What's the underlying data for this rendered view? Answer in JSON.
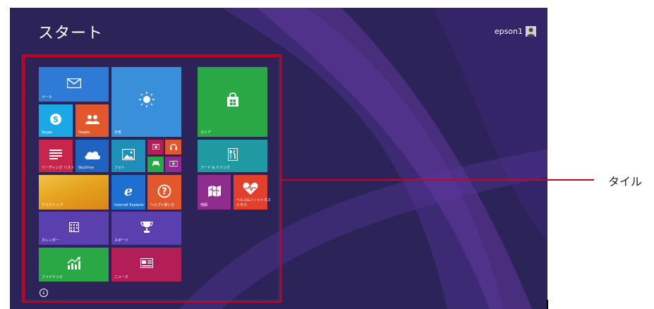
{
  "screen": {
    "title": "スタート",
    "username": "epson1",
    "scroll_glyph": "↓"
  },
  "tiles": {
    "mail": {
      "label": "メール",
      "color": "#2d7bd6",
      "icon": "envelope-icon"
    },
    "weather": {
      "label": "天気",
      "color": "#3a8fdb",
      "icon": "sun-icon"
    },
    "store": {
      "label": "ストア",
      "color": "#2aa845",
      "icon": "shopping-bag-icon"
    },
    "skype": {
      "label": "Skype",
      "color": "#1aa8e6",
      "icon": "skype-icon"
    },
    "people": {
      "label": "People",
      "color": "#e2582c",
      "icon": "people-icon"
    },
    "reading_list": {
      "label": "リーディング リスト",
      "color": "#c8254c",
      "icon": "list-icon"
    },
    "skydrive": {
      "label": "SkyDrive",
      "color": "#1f62c0",
      "icon": "cloud-icon"
    },
    "photos": {
      "label": "フォト",
      "color": "#1e8fb8",
      "icon": "picture-icon"
    },
    "camera": {
      "color": "#b21e55",
      "icon": "camera-icon"
    },
    "music": {
      "color": "#e2582c",
      "icon": "headphones-icon"
    },
    "games": {
      "color": "#2aa845",
      "icon": "gamepad-icon"
    },
    "video": {
      "color": "#8e2d8e",
      "icon": "video-icon"
    },
    "food": {
      "label": "フード & ドリンク",
      "color": "#1e9aa0",
      "icon": "fork-knife-icon"
    },
    "desktop": {
      "label": "デスクトップ",
      "color": "#e6a41e"
    },
    "ie": {
      "label": "Internet Explorer",
      "color": "#1f6fd0",
      "icon": "internet-explorer-icon"
    },
    "help": {
      "label": "ヘルプ+使い方",
      "color": "#e2582c",
      "icon": "question-icon"
    },
    "maps": {
      "label": "地図",
      "color": "#8e2d8e",
      "icon": "map-icon"
    },
    "health": {
      "label": "ヘルス&フィットネス",
      "label_sub": "トネス",
      "color": "#e2402c",
      "icon": "heartbeat-icon"
    },
    "calendar": {
      "label": "カレンダー",
      "color": "#5a3fae",
      "icon": "calendar-icon"
    },
    "sports": {
      "label": "スポーツ",
      "color": "#5a3fae",
      "icon": "trophy-icon"
    },
    "finance": {
      "label": "ファイナンス",
      "color": "#2aa845",
      "icon": "chart-up-icon"
    },
    "news": {
      "label": "ニュース",
      "color": "#b21e55",
      "icon": "newspaper-icon"
    }
  },
  "annotation": {
    "label": "タイル",
    "color": "#d0021b"
  }
}
